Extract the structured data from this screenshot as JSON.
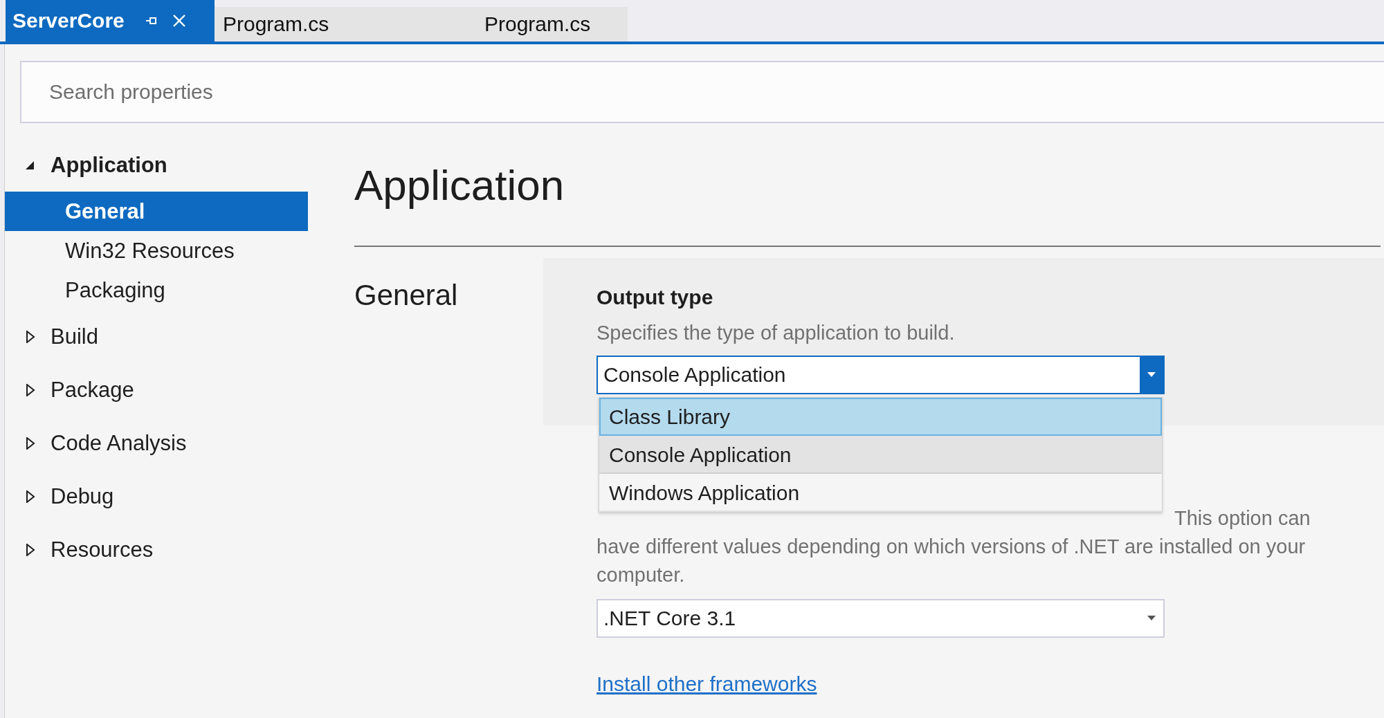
{
  "tabs": [
    {
      "label": "ServerCore",
      "selected": true
    },
    {
      "label": "Program.cs",
      "selected": false
    },
    {
      "label": "Program.cs",
      "selected": false
    }
  ],
  "search": {
    "placeholder": "Search properties"
  },
  "sidebar": {
    "items": [
      {
        "label": "Application",
        "expanded": true,
        "children": [
          {
            "label": "General",
            "selected": true
          },
          {
            "label": "Win32 Resources",
            "selected": false
          },
          {
            "label": "Packaging",
            "selected": false
          }
        ]
      },
      {
        "label": "Build",
        "expanded": false
      },
      {
        "label": "Package",
        "expanded": false
      },
      {
        "label": "Code Analysis",
        "expanded": false
      },
      {
        "label": "Debug",
        "expanded": false
      },
      {
        "label": "Resources",
        "expanded": false
      }
    ]
  },
  "page": {
    "title": "Application",
    "sections": [
      {
        "label": "General",
        "settings": [
          {
            "kind": "dropdown",
            "title": "Output type",
            "description": "Specifies the type of application to build.",
            "value": "Console Application",
            "open": true,
            "options": [
              {
                "label": "Class Library",
                "hovered": true,
                "selected": false
              },
              {
                "label": "Console Application",
                "hovered": false,
                "selected": true
              },
              {
                "label": "Windows Application",
                "hovered": false,
                "selected": false
              }
            ]
          },
          {
            "kind": "dropdown",
            "description": "This option can have different values depending on which versions of .NET are installed on your computer.",
            "value": ".NET Core 3.1",
            "open": false,
            "link": "Install other frameworks"
          }
        ]
      }
    ]
  }
}
